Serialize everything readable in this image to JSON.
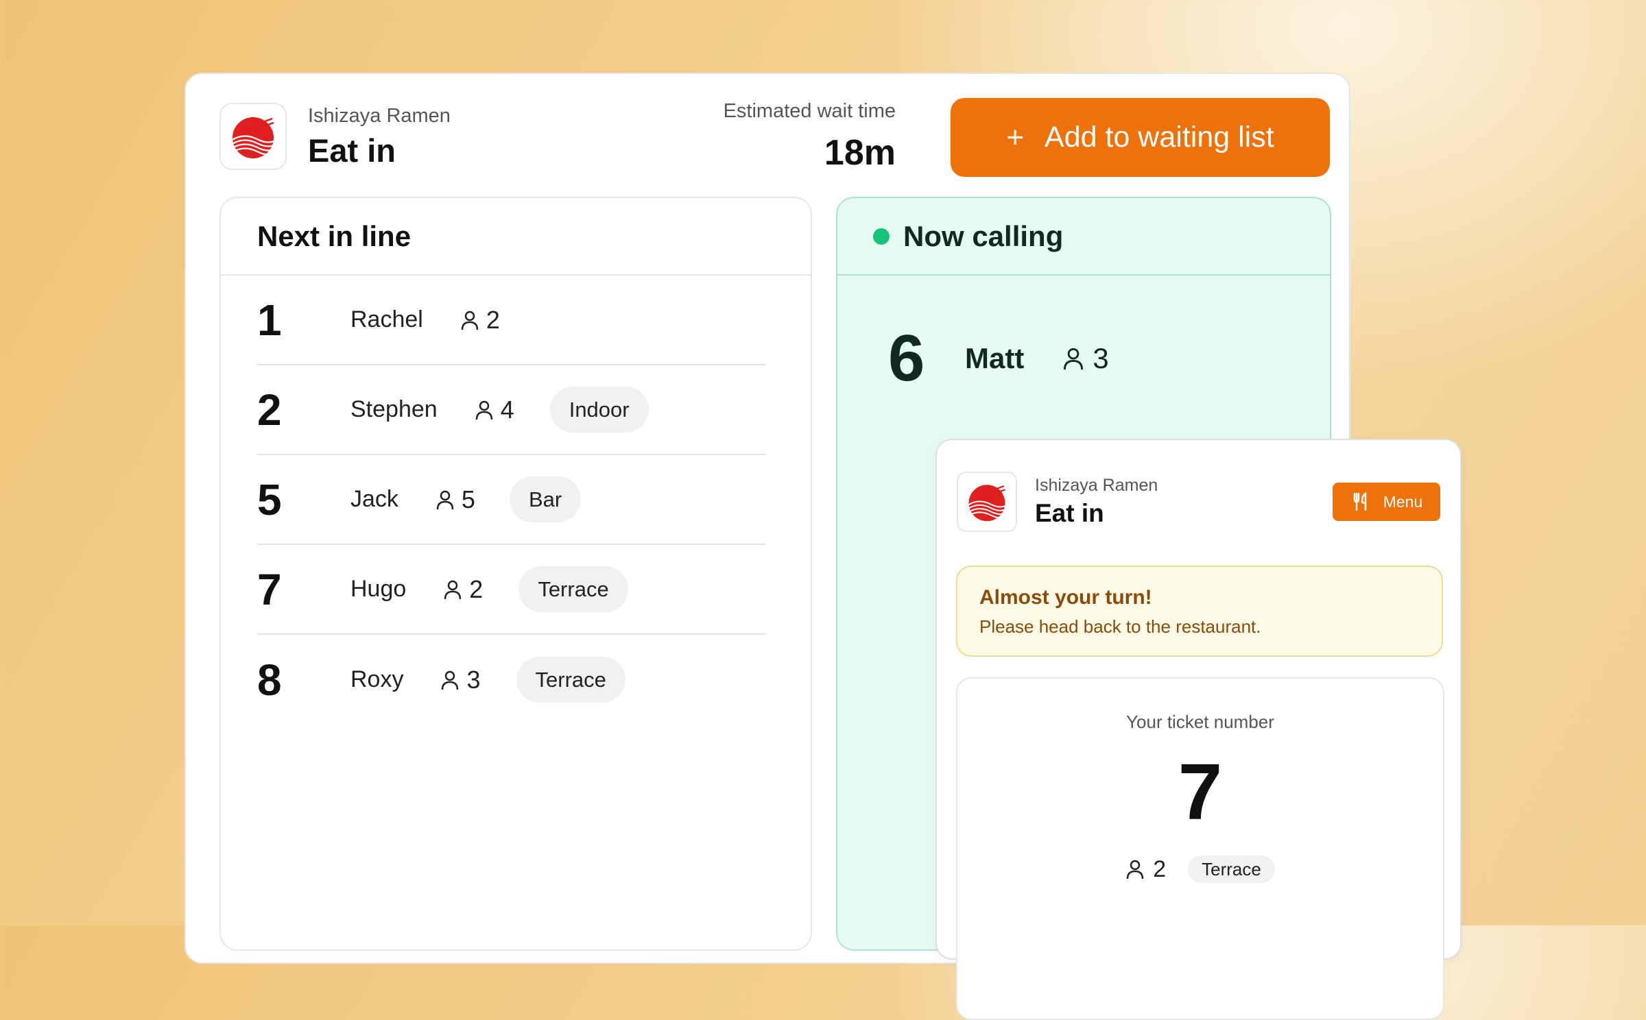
{
  "header": {
    "restaurant": "Ishizaya Ramen",
    "mode": "Eat in",
    "wait_label": "Estimated wait time",
    "wait_value": "18m",
    "add_button_icon": "plus",
    "add_button_label": "Add to waiting list"
  },
  "queue": {
    "title": "Next in line",
    "rows": [
      {
        "number": "1",
        "name": "Rachel",
        "party": "2",
        "tag": ""
      },
      {
        "number": "2",
        "name": "Stephen",
        "party": "4",
        "tag": "Indoor"
      },
      {
        "number": "5",
        "name": "Jack",
        "party": "5",
        "tag": "Bar"
      },
      {
        "number": "7",
        "name": "Hugo",
        "party": "2",
        "tag": "Terrace"
      },
      {
        "number": "8",
        "name": "Roxy",
        "party": "3",
        "tag": "Terrace"
      }
    ]
  },
  "calling": {
    "title": "Now calling",
    "status_color": "#17c27a",
    "number": "6",
    "name": "Matt",
    "party": "3"
  },
  "customer": {
    "restaurant": "Ishizaya Ramen",
    "mode": "Eat in",
    "menu_label": "Menu",
    "alert_title": "Almost your turn!",
    "alert_text": "Please head back to the restaurant.",
    "ticket_label": "Your ticket number",
    "ticket_number": "7",
    "party": "2",
    "tag": "Terrace"
  },
  "colors": {
    "accent": "#ef7109",
    "calling_bg": "#e5fbf2",
    "alert_bg": "#fdfbe7"
  }
}
